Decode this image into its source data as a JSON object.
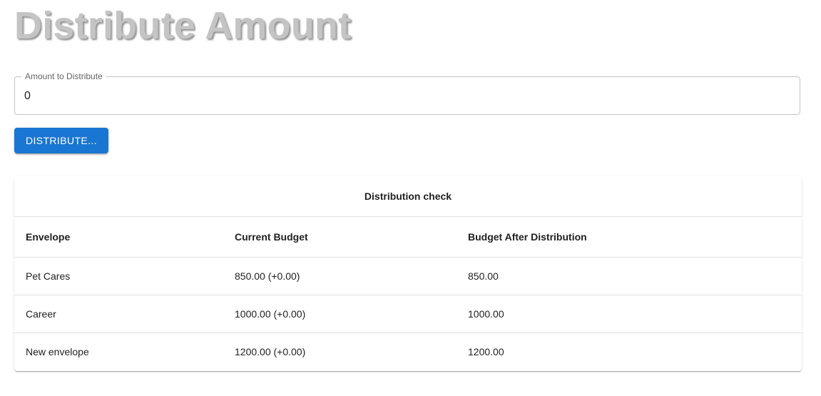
{
  "header": {
    "title": "Distribute Amount"
  },
  "amount_field": {
    "label": "Amount to Distribute",
    "value": "0"
  },
  "actions": {
    "distribute_label": "DISTRIBUTE..."
  },
  "table": {
    "caption": "Distribution check",
    "columns": [
      "Envelope",
      "Current Budget",
      "Budget After Distribution"
    ],
    "rows": [
      [
        "Pet Cares",
        "850.00 (+0.00)",
        "850.00"
      ],
      [
        "Career",
        "1000.00 (+0.00)",
        "1000.00"
      ],
      [
        "New envelope",
        "1200.00 (+0.00)",
        "1200.00"
      ]
    ]
  }
}
